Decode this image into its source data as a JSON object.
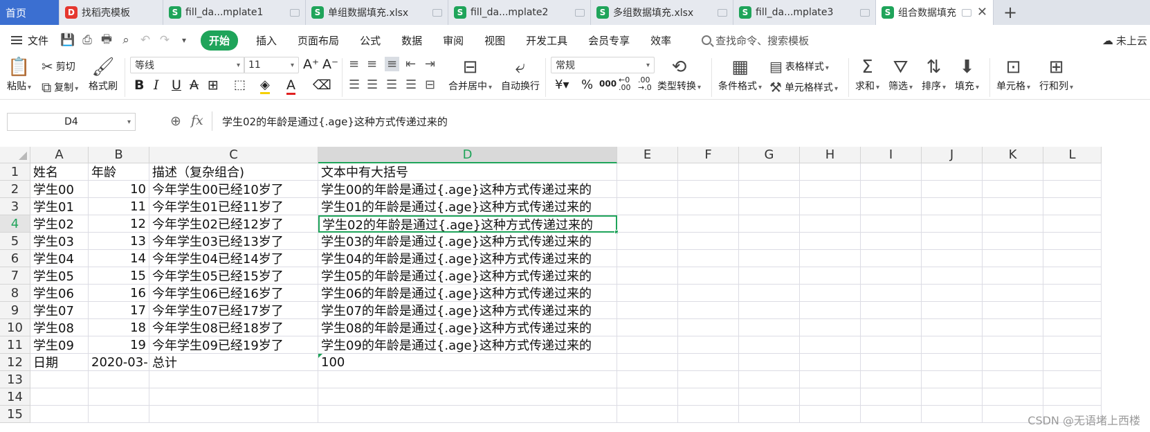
{
  "tabs": [
    {
      "label": "首页",
      "type": "home"
    },
    {
      "label": "找稻壳模板",
      "icon": "docer-icon",
      "glyph": "D"
    },
    {
      "label": "fill_da...mplate1",
      "icon": "sheet-icon",
      "glyph": "S"
    },
    {
      "label": "单组数据填充.xlsx",
      "icon": "sheet-icon",
      "glyph": "S"
    },
    {
      "label": "fill_da...mplate2",
      "icon": "sheet-icon",
      "glyph": "S"
    },
    {
      "label": "多组数据填充.xlsx",
      "icon": "sheet-icon",
      "glyph": "S"
    },
    {
      "label": "fill_da...mplate3",
      "icon": "sheet-icon",
      "glyph": "S"
    },
    {
      "label": "组合数据填充.xlsx",
      "icon": "sheet-icon",
      "glyph": "S",
      "active": true
    }
  ],
  "menu": {
    "file": "文件",
    "tabs": [
      "开始",
      "插入",
      "页面布局",
      "公式",
      "数据",
      "审阅",
      "视图",
      "开发工具",
      "会员专享",
      "效率"
    ],
    "active_tab": "开始",
    "search": "查找命令、搜索模板",
    "cloud": "未上云"
  },
  "ribbon": {
    "paste": "粘贴",
    "cut": "剪切",
    "copy": "复制",
    "format_painter": "格式刷",
    "font_name": "等线",
    "font_size": "11",
    "merge_center": "合并居中",
    "wrap_text": "自动换行",
    "number_format": "常规",
    "type_convert": "类型转换",
    "cond_format": "条件格式",
    "table_style": "表格样式",
    "cell_style": "单元格样式",
    "sum": "求和",
    "filter": "筛选",
    "sort": "排序",
    "fill": "填充",
    "cells": "单元格",
    "row_col": "行和列"
  },
  "formula_bar": {
    "cell_ref": "D4",
    "content": "学生02的年龄是通过{.age}这种方式传递过来的"
  },
  "sheet": {
    "columns": [
      "A",
      "B",
      "C",
      "D",
      "E",
      "F",
      "G",
      "H",
      "I",
      "J",
      "K",
      "L"
    ],
    "selected_column": "D",
    "selected_row": 4,
    "rows": [
      {
        "n": 1,
        "a": "姓名",
        "b": "年龄",
        "c": "描述（复杂组合)",
        "d": "文本中有大括号"
      },
      {
        "n": 2,
        "a": "学生00",
        "b": "10",
        "c": "今年学生00已经10岁了",
        "d": "学生00的年龄是通过{.age}这种方式传递过来的"
      },
      {
        "n": 3,
        "a": "学生01",
        "b": "11",
        "c": "今年学生01已经11岁了",
        "d": "学生01的年龄是通过{.age}这种方式传递过来的"
      },
      {
        "n": 4,
        "a": "学生02",
        "b": "12",
        "c": "今年学生02已经12岁了",
        "d": "学生02的年龄是通过{.age}这种方式传递过来的"
      },
      {
        "n": 5,
        "a": "学生03",
        "b": "13",
        "c": "今年学生03已经13岁了",
        "d": "学生03的年龄是通过{.age}这种方式传递过来的"
      },
      {
        "n": 6,
        "a": "学生04",
        "b": "14",
        "c": "今年学生04已经14岁了",
        "d": "学生04的年龄是通过{.age}这种方式传递过来的"
      },
      {
        "n": 7,
        "a": "学生05",
        "b": "15",
        "c": "今年学生05已经15岁了",
        "d": "学生05的年龄是通过{.age}这种方式传递过来的"
      },
      {
        "n": 8,
        "a": "学生06",
        "b": "16",
        "c": "今年学生06已经16岁了",
        "d": "学生06的年龄是通过{.age}这种方式传递过来的"
      },
      {
        "n": 9,
        "a": "学生07",
        "b": "17",
        "c": "今年学生07已经17岁了",
        "d": "学生07的年龄是通过{.age}这种方式传递过来的"
      },
      {
        "n": 10,
        "a": "学生08",
        "b": "18",
        "c": "今年学生08已经18岁了",
        "d": "学生08的年龄是通过{.age}这种方式传递过来的"
      },
      {
        "n": 11,
        "a": "学生09",
        "b": "19",
        "c": "今年学生09已经19岁了",
        "d": "学生09的年龄是通过{.age}这种方式传递过来的"
      },
      {
        "n": 12,
        "a": "日期",
        "b": "2020-03-",
        "c": "总计",
        "d": "100"
      },
      {
        "n": 13,
        "a": "",
        "b": "",
        "c": "",
        "d": ""
      },
      {
        "n": 14,
        "a": "",
        "b": "",
        "c": "",
        "d": ""
      },
      {
        "n": 15,
        "a": "",
        "b": "",
        "c": "",
        "d": ""
      }
    ]
  },
  "watermark": "CSDN @无语堵上西楼",
  "colors": {
    "accent": "#1fa45a",
    "home_tab": "#3b6fd1"
  }
}
